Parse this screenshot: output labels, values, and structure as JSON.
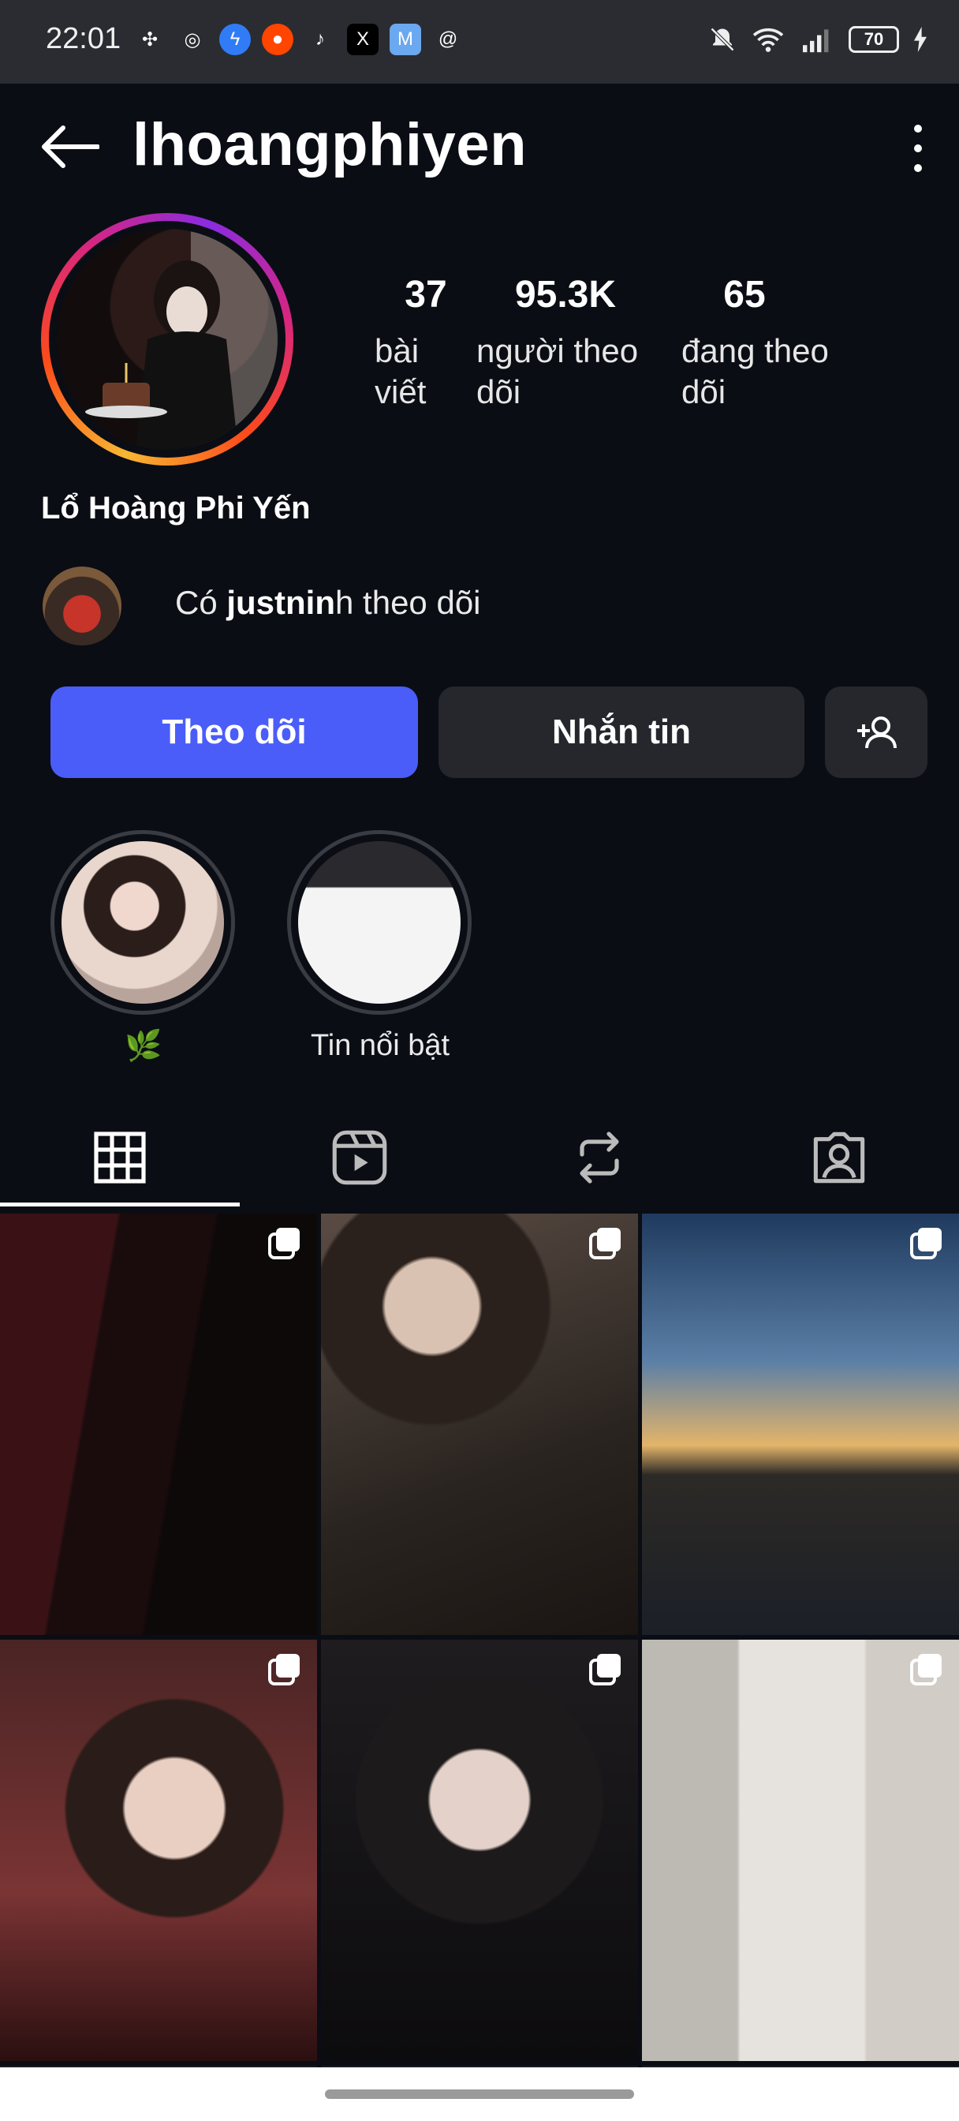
{
  "status": {
    "time": "22:01",
    "battery": "70",
    "left_icons": [
      "pinwheel-icon",
      "camera-icon",
      "messenger-icon",
      "reddit-icon",
      "tiktok-icon",
      "x-icon",
      "mail-icon",
      "threads-icon"
    ],
    "right_icons": [
      "bell-off-icon",
      "wifi-icon",
      "signal-icon",
      "battery-icon",
      "charging-icon"
    ]
  },
  "header": {
    "username": "lhoangphiyen"
  },
  "stats": [
    {
      "value": "37",
      "label_line1": "bài",
      "label_line2": "viết"
    },
    {
      "value": "95.3K",
      "label_line1": "người theo",
      "label_line2": "dõi"
    },
    {
      "value": "65",
      "label_line1": "đang theo",
      "label_line2": "dõi"
    }
  ],
  "profile": {
    "full_name": "Lổ Hoàng Phi Yến"
  },
  "followed_by": {
    "prefix": "Có ",
    "name": "justnin",
    "suffix": "h theo dõi"
  },
  "buttons": {
    "follow": "Theo dõi",
    "message": "Nhắn tin"
  },
  "highlights": [
    {
      "label": "🌿"
    },
    {
      "label": "Tin nổi bật"
    }
  ],
  "tabs": [
    "grid-icon",
    "reels-icon",
    "reposts-icon",
    "tagged-icon"
  ],
  "colors": {
    "accent": "#4a5df9",
    "background": "#0b0d14",
    "button_dark": "#25272d"
  }
}
